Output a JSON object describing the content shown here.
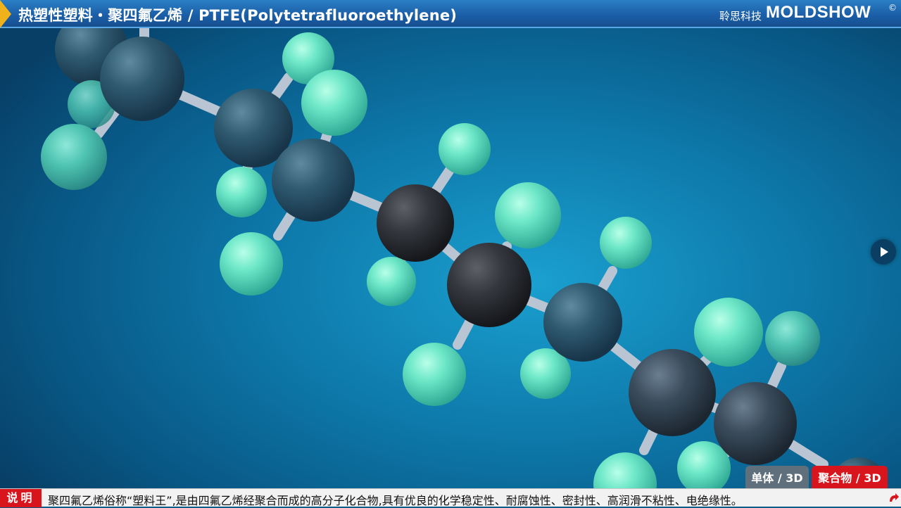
{
  "header": {
    "title": "热塑性塑料・聚四氟乙烯 / PTFE(Polytetrafluoroethylene)",
    "company_cn": "聆思科技",
    "brand": "MOLDSHOW",
    "copyright_mark": "©"
  },
  "viewer": {
    "next_icon": "play-right-icon"
  },
  "modes": {
    "monomer_label": "单体 / 3D",
    "polymer_label": "聚合物 / 3D",
    "active": "polymer"
  },
  "footer": {
    "label": "说明",
    "description": "聚四氟乙烯俗称“塑料王”,是由四氟乙烯经聚合而成的高分子化合物,具有优良的化学稳定性、耐腐蚀性、密封性、高润滑不粘性、电绝缘性。",
    "corner_icon": "flip-arrow-icon"
  },
  "colors": {
    "title_bar": "#1b5fa8",
    "accent_red": "#d8151c",
    "carbon": "#3a4a58",
    "fluorine": "#6fe0c4",
    "bond": "#b8c4d2"
  }
}
